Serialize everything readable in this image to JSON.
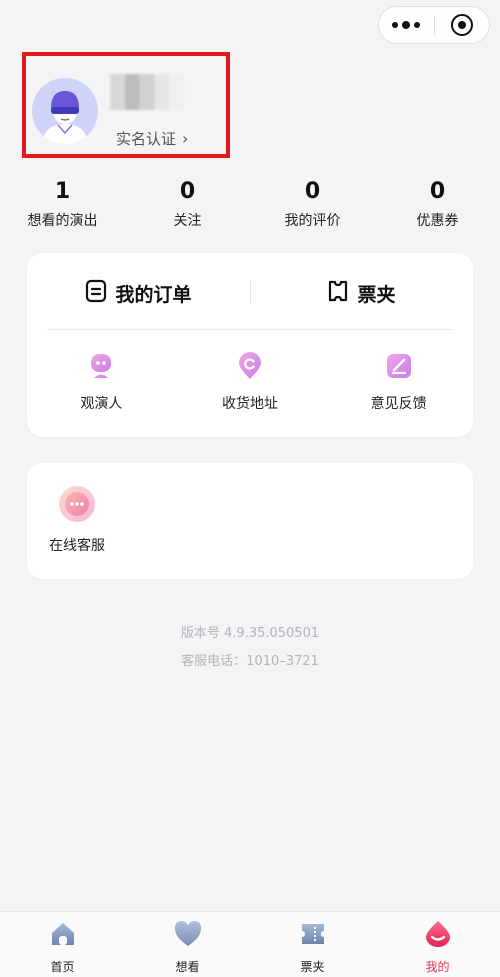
{
  "capsule": {
    "more_icon": "ellipsis-icon",
    "close_icon": "target-icon"
  },
  "profile": {
    "verify_label": "实名认证",
    "verify_chevron": "›"
  },
  "stats": [
    {
      "value": "1",
      "label": "想看的演出"
    },
    {
      "value": "0",
      "label": "关注"
    },
    {
      "value": "0",
      "label": "我的评价"
    },
    {
      "value": "0",
      "label": "优惠券"
    }
  ],
  "orders": {
    "my_orders": "我的订单",
    "ticket_folder": "票夹"
  },
  "shortcuts": [
    {
      "label": "观演人",
      "icon": "viewer-icon"
    },
    {
      "label": "收货地址",
      "icon": "location-icon"
    },
    {
      "label": "意见反馈",
      "icon": "feedback-icon"
    }
  ],
  "service": {
    "label": "在线客服",
    "icon": "customer-service-icon"
  },
  "footer": {
    "version": "版本号 4.9.35.050501",
    "hotline": "客服电话：1010–3721"
  },
  "tabbar": [
    {
      "label": "首页",
      "icon": "home-icon"
    },
    {
      "label": "想看",
      "icon": "heart-icon"
    },
    {
      "label": "票夹",
      "icon": "ticket-icon"
    },
    {
      "label": "我的",
      "icon": "profile-icon",
      "active": true
    }
  ],
  "colors": {
    "accent": "#e8365a",
    "highlight_border": "#e01b1b",
    "shortcut_pink": "#e8a0e8"
  }
}
